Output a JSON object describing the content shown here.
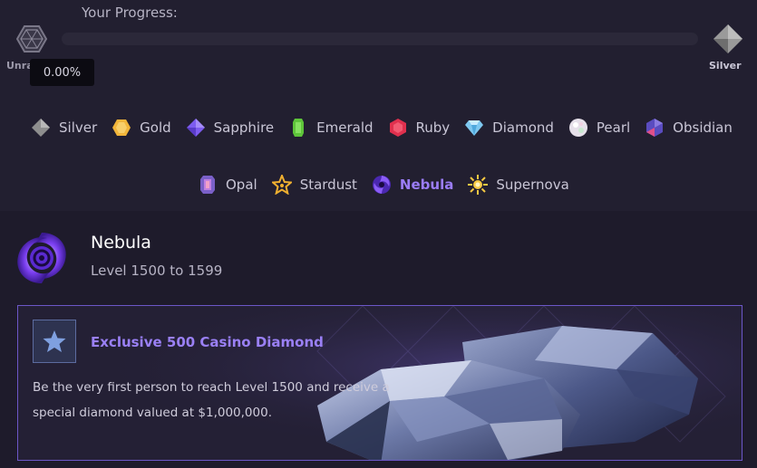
{
  "progress": {
    "label": "Your Progress:",
    "value_percent": 0,
    "tooltip": "0.00%",
    "current_rank": "Unranked",
    "next_rank": "Silver"
  },
  "tiers_row1": [
    {
      "name": "Silver",
      "icon": "silver-diamond-icon",
      "color": "#8e8e8e"
    },
    {
      "name": "Gold",
      "icon": "gold-hexagon-icon",
      "color": "#f2b53a"
    },
    {
      "name": "Sapphire",
      "icon": "sapphire-gem-icon",
      "color": "#7d5cf0"
    },
    {
      "name": "Emerald",
      "icon": "emerald-gem-icon",
      "color": "#5ec43a"
    },
    {
      "name": "Ruby",
      "icon": "ruby-gem-icon",
      "color": "#e0304e"
    },
    {
      "name": "Diamond",
      "icon": "diamond-icon",
      "color": "#7ec8f0"
    },
    {
      "name": "Pearl",
      "icon": "pearl-icon",
      "color": "#e6e0ea"
    },
    {
      "name": "Obsidian",
      "icon": "obsidian-gem-icon",
      "color": "#5a4cc0"
    }
  ],
  "tiers_row2": [
    {
      "name": "Opal",
      "icon": "opal-gem-icon",
      "color": "#c080e0"
    },
    {
      "name": "Stardust",
      "icon": "stardust-star-icon",
      "color": "#f0b030"
    },
    {
      "name": "Nebula",
      "icon": "nebula-swirl-icon",
      "color": "#8b5cf6",
      "active": true
    },
    {
      "name": "Supernova",
      "icon": "supernova-sun-icon",
      "color": "#f5c842"
    }
  ],
  "level": {
    "title": "Nebula",
    "range": "Level 1500 to 1599"
  },
  "reward": {
    "title": "Exclusive 500 Casino Diamond",
    "description": "Be the very first person to reach Level 1500 and receive a special diamond valued at $1,000,000."
  },
  "colors": {
    "accent": "#9b7df7",
    "card_border": "#6c57c8",
    "background": "#221f30"
  }
}
